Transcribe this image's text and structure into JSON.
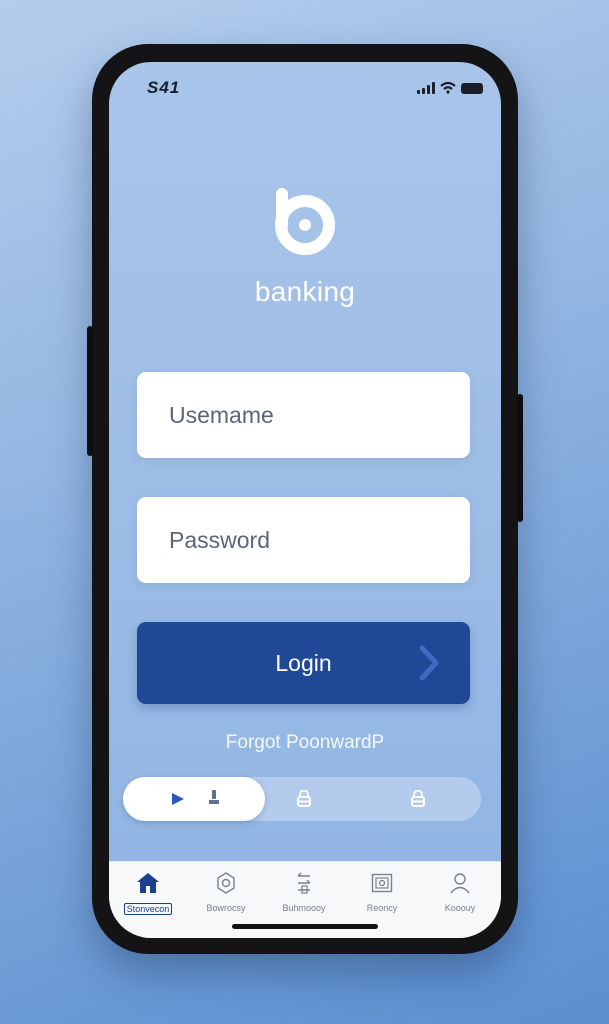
{
  "status_bar": {
    "time": "S41"
  },
  "brand": {
    "name": "banking"
  },
  "login_form": {
    "username_placeholder": "Usemame",
    "password_placeholder": "Password",
    "login_label": "Login",
    "forgot_label": "Forgot PoonwardP"
  },
  "toggle": {
    "selected_index": 0
  },
  "tabbar": {
    "items": [
      {
        "label": "Stonvecon",
        "icon": "home-icon",
        "active": true
      },
      {
        "label": "Bowrocsy",
        "icon": "settings-icon",
        "active": false
      },
      {
        "label": "Buhmoooy",
        "icon": "transfer-icon",
        "active": false
      },
      {
        "label": "Reoncy",
        "icon": "safe-icon",
        "active": false
      },
      {
        "label": "Kooouy",
        "icon": "profile-icon",
        "active": false
      }
    ]
  },
  "colors": {
    "primary": "#1f4897",
    "background": "#9cbce6",
    "text_light": "#ffffff",
    "active_tab": "#1c3f8f"
  }
}
